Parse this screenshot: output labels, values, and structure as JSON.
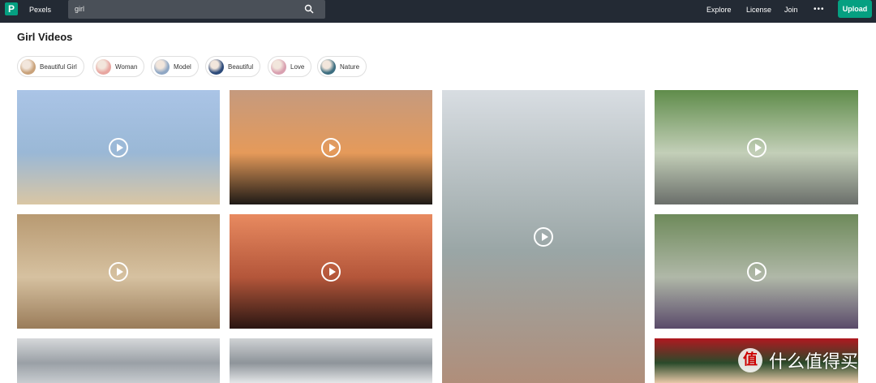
{
  "header": {
    "logo_letter": "P",
    "brand": "Pexels",
    "search_value": "girl",
    "nav": [
      "Explore",
      "License",
      "Join"
    ],
    "more_label": "•••",
    "upload_label": "Upload"
  },
  "page": {
    "title": "Girl Videos"
  },
  "chips": [
    {
      "label": "Beautiful Girl",
      "color": "#c9a27a"
    },
    {
      "label": "Woman",
      "color": "#e8a6a0"
    },
    {
      "label": "Model",
      "color": "#8fa7c4"
    },
    {
      "label": "Beautiful",
      "color": "#2c4a7a"
    },
    {
      "label": "Love",
      "color": "#d9a0b0"
    },
    {
      "label": "Nature",
      "color": "#3d6e80"
    }
  ],
  "videos": [
    {
      "name": "beach-girl",
      "colors": [
        "#aac4e6",
        "#9ab8d6",
        "#d9c6a4"
      ]
    },
    {
      "name": "sunset-silhouette",
      "colors": [
        "#c59a7e",
        "#e59a5a",
        "#1e1a16"
      ]
    },
    {
      "name": "fitness-woman",
      "colors": [
        "#d8dde2",
        "#9aa6a6",
        "#b08e7a"
      ]
    },
    {
      "name": "friends-group",
      "colors": [
        "#5f8c4a",
        "#c3cfb8",
        "#6a6e6a"
      ]
    },
    {
      "name": "arches-corridor",
      "colors": [
        "#b89a72",
        "#d6c1a0",
        "#9a7c5a"
      ]
    },
    {
      "name": "face-silhouette",
      "colors": [
        "#e88a60",
        "#b4563a",
        "#2a1612"
      ]
    },
    {
      "name": "woman-portrait",
      "colors": [
        "#6e8a5a",
        "#b0b8a8",
        "#5a4a6a"
      ]
    },
    {
      "name": "architecture-1",
      "colors": [
        "#d6d8da",
        "#9aa0a6",
        "#c8ccd0"
      ]
    },
    {
      "name": "architecture-2",
      "colors": [
        "#cfd2d4",
        "#8e949a",
        "#e4e6e8"
      ]
    },
    {
      "name": "christmas-girl",
      "colors": [
        "#b01820",
        "#2a4a2a",
        "#e8c8a8"
      ]
    }
  ],
  "watermark": {
    "logo": "值",
    "text": "什么值得买"
  }
}
